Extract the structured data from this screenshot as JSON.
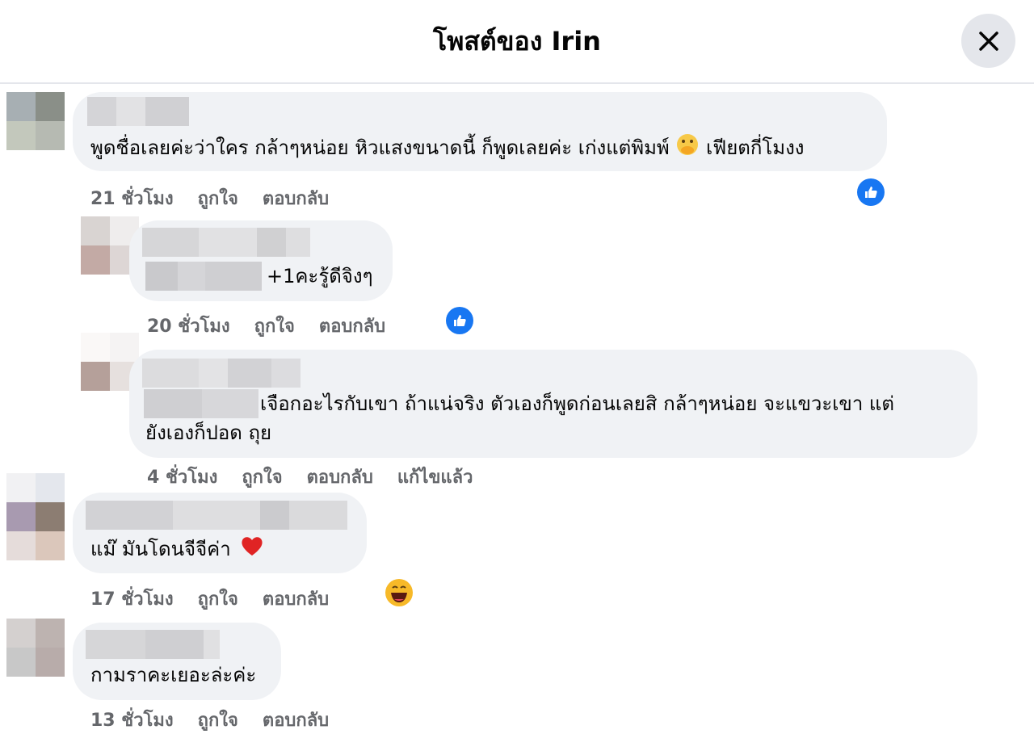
{
  "header": {
    "title": "โพสต์ของ Irin",
    "close_icon": "close-icon"
  },
  "comments": [
    {
      "text": "พูดชื่อเลยค่ะว่าใคร กล้าๆหน่อย หิวแสงขนาดนี้ ก็พูดเลยค่ะ เก่งแต่พิมพ์",
      "text_after_emoji": "เฟียตกี่โมงง",
      "inline_emoji": "face-with-hand-over-mouth-emoji",
      "time": "21 ชั่วโมง",
      "like": "ถูกใจ",
      "reply": "ตอบกลับ",
      "reaction": "like-icon"
    },
    {
      "text": "+1คะรู้ดีจิงๆ",
      "time": "20 ชั่วโมง",
      "like": "ถูกใจ",
      "reply": "ตอบกลับ",
      "reaction": "like-icon"
    },
    {
      "text_line1": "เจือกอะไรกับเขา ถ้าแน่จริง ตัวเองก็พูดก่อนเลยสิ กล้าๆหน่อย จะแขวะเขา แต่",
      "text_line2": "ยังเองก็ปอด ถุย",
      "time": "4 ชั่วโมง",
      "like": "ถูกใจ",
      "reply": "ตอบกลับ",
      "edited": "แก้ไขแล้ว"
    },
    {
      "text": "แม๊ มันโดนจีจีค่า",
      "inline_emoji": "red-heart-emoji",
      "time": "17 ชั่วโมง",
      "like": "ถูกใจ",
      "reply": "ตอบกลับ",
      "reaction": "laughing-face-icon"
    },
    {
      "text": "กามราคะเยอะล่ะค่ะ",
      "time": "13 ชั่วโมง",
      "like": "ถูกใจ",
      "reply": "ตอบกลับ"
    }
  ],
  "colors": {
    "bubble": "#f0f2f5",
    "meta_text": "#65676b",
    "like_blue": "#1877f2",
    "heart_red": "#e0245e"
  }
}
